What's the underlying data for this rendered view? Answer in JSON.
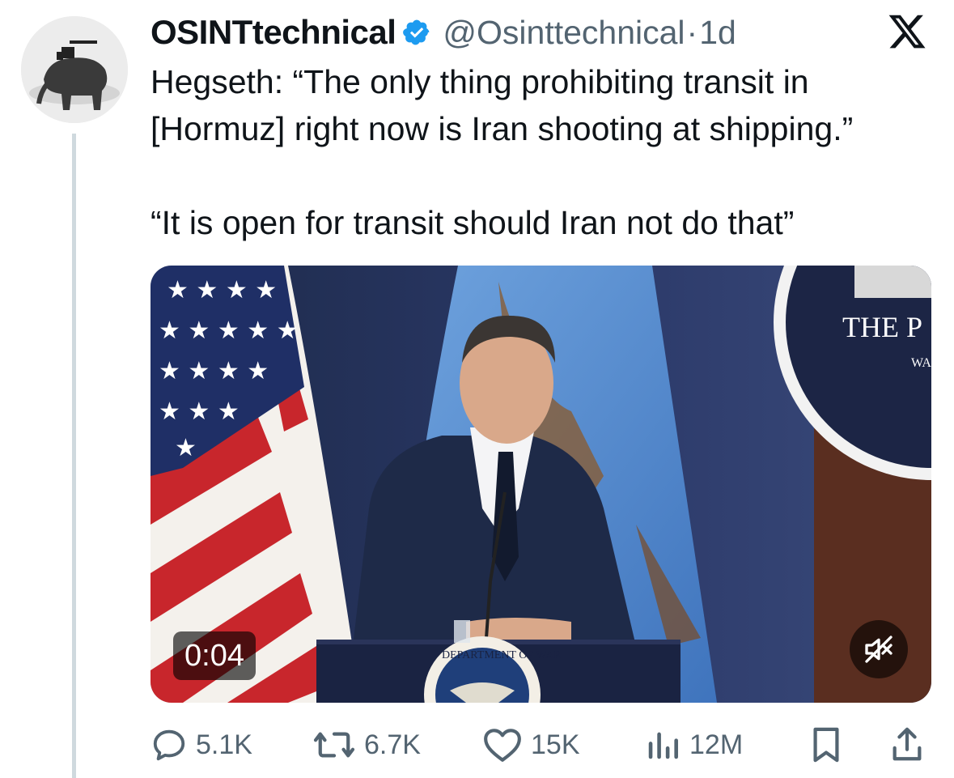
{
  "tweet": {
    "display_name": "OSINTtechnical",
    "handle": "@Osinttechnical",
    "separator": "·",
    "age": "1d",
    "text_lines": [
      "Hegseth: “The only thing prohibiting transit in",
      "[Hormuz] right now is Iran shooting at shipping.”",
      "“It is open for transit should Iran not do that”"
    ]
  },
  "media": {
    "duration": "0:04",
    "seal_text": "DEPARTMENT OF WAR",
    "backdrop_text": "THE P",
    "backdrop_text_small": "WA"
  },
  "actions": {
    "replies": "5.1K",
    "reposts": "6.7K",
    "likes": "15K",
    "views": "12M"
  },
  "icons": [
    "verified-badge-icon",
    "x-logo-icon",
    "reply-icon",
    "repost-icon",
    "like-icon",
    "views-icon",
    "bookmark-icon",
    "share-icon",
    "mute-icon"
  ],
  "colors": {
    "verified": "#1d9bf0",
    "secondary_text": "#536471",
    "thread_line": "#cfd9de"
  }
}
